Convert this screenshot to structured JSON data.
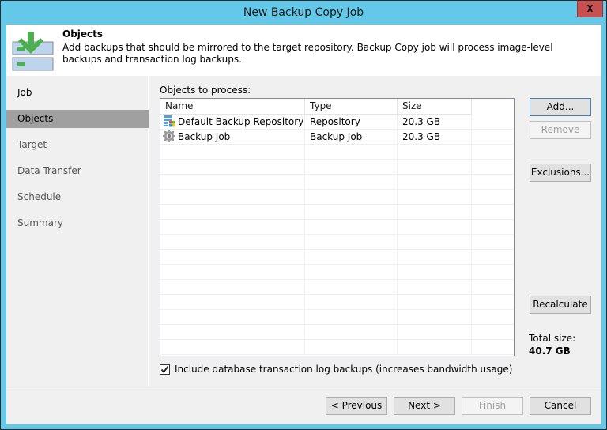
{
  "window": {
    "title": "New Backup Copy Job",
    "close_label": "X"
  },
  "header": {
    "icon": "backup-download-icon",
    "title": "Objects",
    "description": "Add backups that should be mirrored to the target repository. Backup Copy job will process image-level backups and transaction log backups."
  },
  "steps": [
    {
      "label": "Job",
      "state": "done"
    },
    {
      "label": "Objects",
      "state": "active"
    },
    {
      "label": "Target",
      "state": "pending"
    },
    {
      "label": "Data Transfer",
      "state": "pending"
    },
    {
      "label": "Schedule",
      "state": "pending"
    },
    {
      "label": "Summary",
      "state": "pending"
    }
  ],
  "objects": {
    "label": "Objects to process:",
    "columns": [
      "Name",
      "Type",
      "Size"
    ],
    "rows": [
      {
        "icon": "repository-icon",
        "name": "Default Backup Repository",
        "type": "Repository",
        "size": "20.3 GB"
      },
      {
        "icon": "gear-icon",
        "name": "Backup Job",
        "type": "Backup Job",
        "size": "20.3 GB"
      }
    ]
  },
  "side_buttons": {
    "add": "Add...",
    "remove": "Remove",
    "exclusions": "Exclusions...",
    "recalculate": "Recalculate"
  },
  "total": {
    "label": "Total size:",
    "value": "40.7 GB"
  },
  "include_log": {
    "checked": true,
    "label": "Include database transaction log backups (increases bandwidth usage)"
  },
  "footer": {
    "previous": "< Previous",
    "next": "Next >",
    "finish": "Finish",
    "cancel": "Cancel"
  }
}
